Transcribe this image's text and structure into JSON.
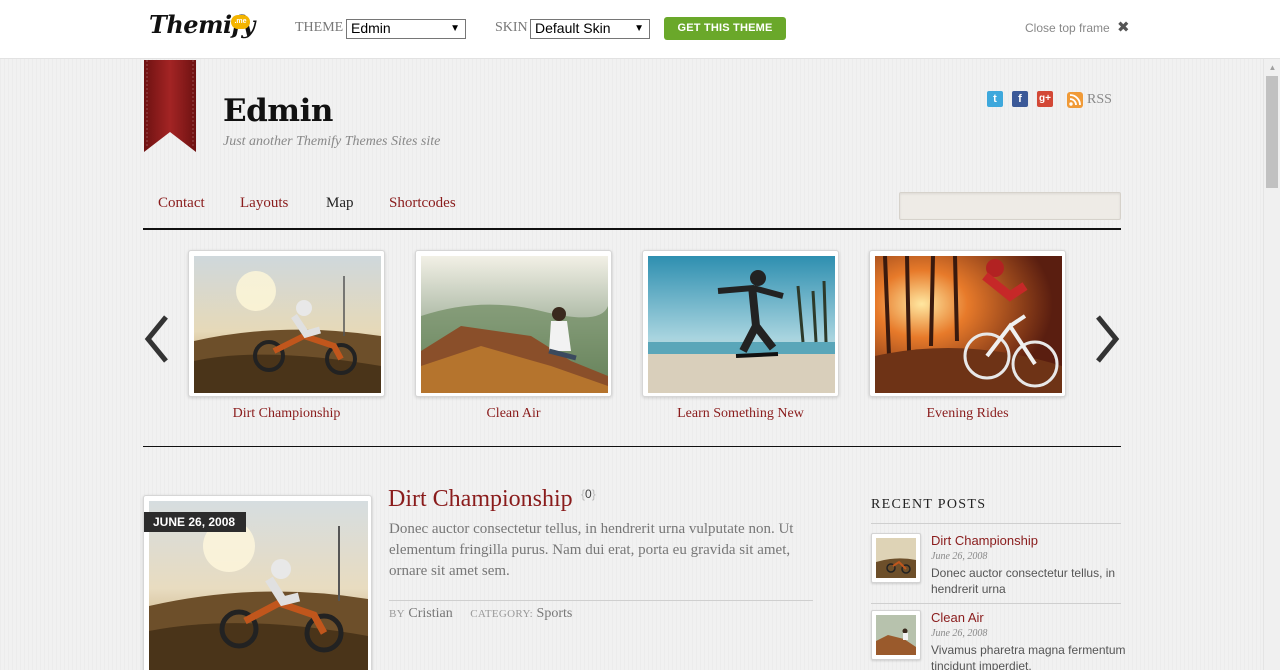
{
  "topframe": {
    "logo": "Themify",
    "logo_badge": ".me",
    "theme_label": "THEME",
    "theme_value": "Edmin",
    "skin_label": "SKIN",
    "skin_value": "Default Skin",
    "get_button": "GET THIS THEME",
    "close_label": "Close top frame",
    "close_icon": "✖"
  },
  "site": {
    "title": "Edmin",
    "tagline": "Just another Themify Themes Sites site",
    "rss_label": "RSS"
  },
  "nav": {
    "items": [
      "Contact",
      "Layouts",
      "Map",
      "Shortcodes"
    ],
    "active": "Map"
  },
  "slider": {
    "slides": [
      {
        "caption": "Dirt Championship",
        "image": "dirt-bike-photo"
      },
      {
        "caption": "Clean Air",
        "image": "hiker-cliff-photo"
      },
      {
        "caption": "Learn Something New",
        "image": "skateboarder-photo"
      },
      {
        "caption": "Evening Rides",
        "image": "mountain-bike-photo"
      }
    ]
  },
  "post": {
    "date": "JUNE 26, 2008",
    "title": "Dirt Championship",
    "comments": "0",
    "excerpt": "Donec auctor consectetur tellus, in hendrerit urna vulputate non. Ut elementum fringilla purus. Nam dui erat, porta eu gravida sit amet, ornare sit amet sem.",
    "by_label": "BY",
    "author": "Cristian",
    "category_label": "CATEGORY:",
    "category": "Sports"
  },
  "sidebar": {
    "heading": "RECENT POSTS",
    "posts": [
      {
        "title": "Dirt Championship",
        "date": "June 26, 2008",
        "excerpt": "Donec auctor consectetur tellus, in hendrerit urna"
      },
      {
        "title": "Clean Air",
        "date": "June 26, 2008",
        "excerpt": "Vivamus pharetra magna fermentum tincidunt imperdiet."
      }
    ]
  },
  "colors": {
    "accent": "#8a1c1c",
    "button_green": "#6aa82a",
    "date_badge": "#2c2c2c"
  }
}
